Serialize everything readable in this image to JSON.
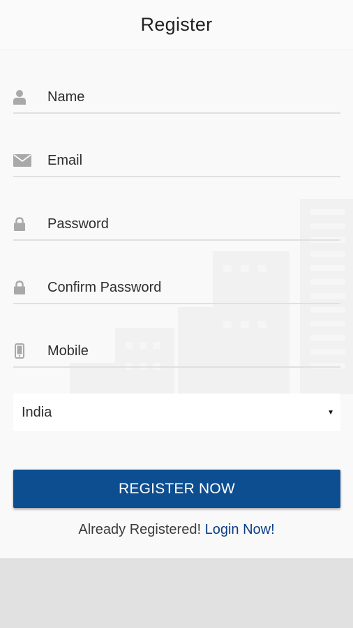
{
  "header": {
    "title": "Register"
  },
  "form": {
    "name": {
      "placeholder": "Name",
      "icon": "user-icon"
    },
    "email": {
      "placeholder": "Email",
      "icon": "envelope-icon"
    },
    "password": {
      "placeholder": "Password",
      "icon": "lock-icon"
    },
    "confirm_password": {
      "placeholder": "Confirm Password",
      "icon": "lock-icon"
    },
    "mobile": {
      "placeholder": "Mobile",
      "icon": "phone-icon"
    },
    "country": {
      "selected": "India"
    }
  },
  "actions": {
    "register_label": "REGISTER NOW",
    "already_registered_text": "Already Registered!",
    "login_link_label": "Login Now!"
  },
  "colors": {
    "primary": "#0d4e91",
    "link": "#0d3d86",
    "background": "#f9f9f9",
    "bottom_area": "#e1e1e1"
  }
}
